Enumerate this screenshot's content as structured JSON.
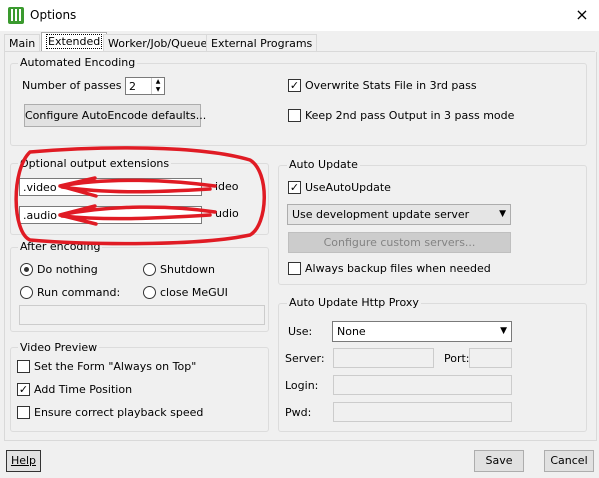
{
  "window": {
    "title": "Options",
    "close_icon": "×"
  },
  "tabs": [
    {
      "label": "Main"
    },
    {
      "label": "Extended",
      "active": true
    },
    {
      "label": "Worker/Job/Queue"
    },
    {
      "label": "External Programs"
    }
  ],
  "automated_encoding": {
    "title": "Automated Encoding",
    "passes_label": "Number of passes",
    "passes_value": "2",
    "configure_button": "Configure AutoEncode defaults...",
    "overwrite_stats": {
      "label": "Overwrite Stats File in 3rd pass",
      "checked": true
    },
    "keep_2nd_pass": {
      "label": "Keep 2nd pass Output in 3 pass mode",
      "checked": false
    }
  },
  "optional_output": {
    "title": "Optional output extensions",
    "video_value": ".video",
    "audio_value": ".audio",
    "video_suffix": "ideo",
    "audio_suffix": "udio",
    "annotation_color": "#e01b24"
  },
  "auto_update": {
    "title": "Auto Update",
    "use_auto_update": {
      "label": "UseAutoUpdate",
      "checked": true
    },
    "server_select": "Use development update server",
    "configure_servers_button": "Configure custom servers...",
    "always_backup": {
      "label": "Always backup files when needed",
      "checked": false
    }
  },
  "after_encoding": {
    "title": "After encoding",
    "do_nothing": {
      "label": "Do nothing",
      "selected": true
    },
    "shutdown": {
      "label": "Shutdown",
      "selected": false
    },
    "run_command": {
      "label": "Run command:",
      "selected": false
    },
    "close_megui": {
      "label": "close MeGUI",
      "selected": false
    }
  },
  "video_preview": {
    "title": "Video Preview",
    "always_on_top": {
      "label": "Set the Form \"Always on Top\"",
      "checked": false
    },
    "add_time_position": {
      "label": "Add Time Position",
      "checked": true
    },
    "correct_playback": {
      "label": "Ensure correct playback speed",
      "checked": false
    }
  },
  "proxy": {
    "title": "Auto Update Http Proxy",
    "use_label": "Use:",
    "use_value": "None",
    "server_label": "Server:",
    "port_label": "Port:",
    "login_label": "Login:",
    "pwd_label": "Pwd:"
  },
  "footer": {
    "help": "Help",
    "save": "Save",
    "cancel": "Cancel"
  }
}
